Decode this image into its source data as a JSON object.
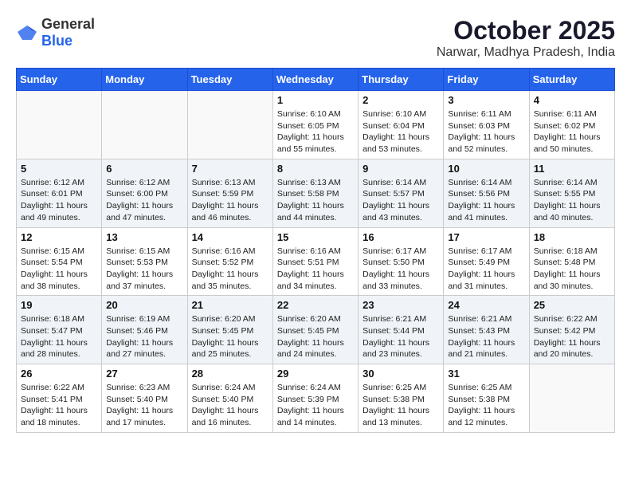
{
  "logo": {
    "general": "General",
    "blue": "Blue"
  },
  "title": "October 2025",
  "location": "Narwar, Madhya Pradesh, India",
  "days_of_week": [
    "Sunday",
    "Monday",
    "Tuesday",
    "Wednesday",
    "Thursday",
    "Friday",
    "Saturday"
  ],
  "weeks": [
    [
      {
        "day": "",
        "sunrise": "",
        "sunset": "",
        "daylight": ""
      },
      {
        "day": "",
        "sunrise": "",
        "sunset": "",
        "daylight": ""
      },
      {
        "day": "",
        "sunrise": "",
        "sunset": "",
        "daylight": ""
      },
      {
        "day": "1",
        "sunrise": "Sunrise: 6:10 AM",
        "sunset": "Sunset: 6:05 PM",
        "daylight": "Daylight: 11 hours and 55 minutes."
      },
      {
        "day": "2",
        "sunrise": "Sunrise: 6:10 AM",
        "sunset": "Sunset: 6:04 PM",
        "daylight": "Daylight: 11 hours and 53 minutes."
      },
      {
        "day": "3",
        "sunrise": "Sunrise: 6:11 AM",
        "sunset": "Sunset: 6:03 PM",
        "daylight": "Daylight: 11 hours and 52 minutes."
      },
      {
        "day": "4",
        "sunrise": "Sunrise: 6:11 AM",
        "sunset": "Sunset: 6:02 PM",
        "daylight": "Daylight: 11 hours and 50 minutes."
      }
    ],
    [
      {
        "day": "5",
        "sunrise": "Sunrise: 6:12 AM",
        "sunset": "Sunset: 6:01 PM",
        "daylight": "Daylight: 11 hours and 49 minutes."
      },
      {
        "day": "6",
        "sunrise": "Sunrise: 6:12 AM",
        "sunset": "Sunset: 6:00 PM",
        "daylight": "Daylight: 11 hours and 47 minutes."
      },
      {
        "day": "7",
        "sunrise": "Sunrise: 6:13 AM",
        "sunset": "Sunset: 5:59 PM",
        "daylight": "Daylight: 11 hours and 46 minutes."
      },
      {
        "day": "8",
        "sunrise": "Sunrise: 6:13 AM",
        "sunset": "Sunset: 5:58 PM",
        "daylight": "Daylight: 11 hours and 44 minutes."
      },
      {
        "day": "9",
        "sunrise": "Sunrise: 6:14 AM",
        "sunset": "Sunset: 5:57 PM",
        "daylight": "Daylight: 11 hours and 43 minutes."
      },
      {
        "day": "10",
        "sunrise": "Sunrise: 6:14 AM",
        "sunset": "Sunset: 5:56 PM",
        "daylight": "Daylight: 11 hours and 41 minutes."
      },
      {
        "day": "11",
        "sunrise": "Sunrise: 6:14 AM",
        "sunset": "Sunset: 5:55 PM",
        "daylight": "Daylight: 11 hours and 40 minutes."
      }
    ],
    [
      {
        "day": "12",
        "sunrise": "Sunrise: 6:15 AM",
        "sunset": "Sunset: 5:54 PM",
        "daylight": "Daylight: 11 hours and 38 minutes."
      },
      {
        "day": "13",
        "sunrise": "Sunrise: 6:15 AM",
        "sunset": "Sunset: 5:53 PM",
        "daylight": "Daylight: 11 hours and 37 minutes."
      },
      {
        "day": "14",
        "sunrise": "Sunrise: 6:16 AM",
        "sunset": "Sunset: 5:52 PM",
        "daylight": "Daylight: 11 hours and 35 minutes."
      },
      {
        "day": "15",
        "sunrise": "Sunrise: 6:16 AM",
        "sunset": "Sunset: 5:51 PM",
        "daylight": "Daylight: 11 hours and 34 minutes."
      },
      {
        "day": "16",
        "sunrise": "Sunrise: 6:17 AM",
        "sunset": "Sunset: 5:50 PM",
        "daylight": "Daylight: 11 hours and 33 minutes."
      },
      {
        "day": "17",
        "sunrise": "Sunrise: 6:17 AM",
        "sunset": "Sunset: 5:49 PM",
        "daylight": "Daylight: 11 hours and 31 minutes."
      },
      {
        "day": "18",
        "sunrise": "Sunrise: 6:18 AM",
        "sunset": "Sunset: 5:48 PM",
        "daylight": "Daylight: 11 hours and 30 minutes."
      }
    ],
    [
      {
        "day": "19",
        "sunrise": "Sunrise: 6:18 AM",
        "sunset": "Sunset: 5:47 PM",
        "daylight": "Daylight: 11 hours and 28 minutes."
      },
      {
        "day": "20",
        "sunrise": "Sunrise: 6:19 AM",
        "sunset": "Sunset: 5:46 PM",
        "daylight": "Daylight: 11 hours and 27 minutes."
      },
      {
        "day": "21",
        "sunrise": "Sunrise: 6:20 AM",
        "sunset": "Sunset: 5:45 PM",
        "daylight": "Daylight: 11 hours and 25 minutes."
      },
      {
        "day": "22",
        "sunrise": "Sunrise: 6:20 AM",
        "sunset": "Sunset: 5:45 PM",
        "daylight": "Daylight: 11 hours and 24 minutes."
      },
      {
        "day": "23",
        "sunrise": "Sunrise: 6:21 AM",
        "sunset": "Sunset: 5:44 PM",
        "daylight": "Daylight: 11 hours and 23 minutes."
      },
      {
        "day": "24",
        "sunrise": "Sunrise: 6:21 AM",
        "sunset": "Sunset: 5:43 PM",
        "daylight": "Daylight: 11 hours and 21 minutes."
      },
      {
        "day": "25",
        "sunrise": "Sunrise: 6:22 AM",
        "sunset": "Sunset: 5:42 PM",
        "daylight": "Daylight: 11 hours and 20 minutes."
      }
    ],
    [
      {
        "day": "26",
        "sunrise": "Sunrise: 6:22 AM",
        "sunset": "Sunset: 5:41 PM",
        "daylight": "Daylight: 11 hours and 18 minutes."
      },
      {
        "day": "27",
        "sunrise": "Sunrise: 6:23 AM",
        "sunset": "Sunset: 5:40 PM",
        "daylight": "Daylight: 11 hours and 17 minutes."
      },
      {
        "day": "28",
        "sunrise": "Sunrise: 6:24 AM",
        "sunset": "Sunset: 5:40 PM",
        "daylight": "Daylight: 11 hours and 16 minutes."
      },
      {
        "day": "29",
        "sunrise": "Sunrise: 6:24 AM",
        "sunset": "Sunset: 5:39 PM",
        "daylight": "Daylight: 11 hours and 14 minutes."
      },
      {
        "day": "30",
        "sunrise": "Sunrise: 6:25 AM",
        "sunset": "Sunset: 5:38 PM",
        "daylight": "Daylight: 11 hours and 13 minutes."
      },
      {
        "day": "31",
        "sunrise": "Sunrise: 6:25 AM",
        "sunset": "Sunset: 5:38 PM",
        "daylight": "Daylight: 11 hours and 12 minutes."
      },
      {
        "day": "",
        "sunrise": "",
        "sunset": "",
        "daylight": ""
      }
    ]
  ]
}
